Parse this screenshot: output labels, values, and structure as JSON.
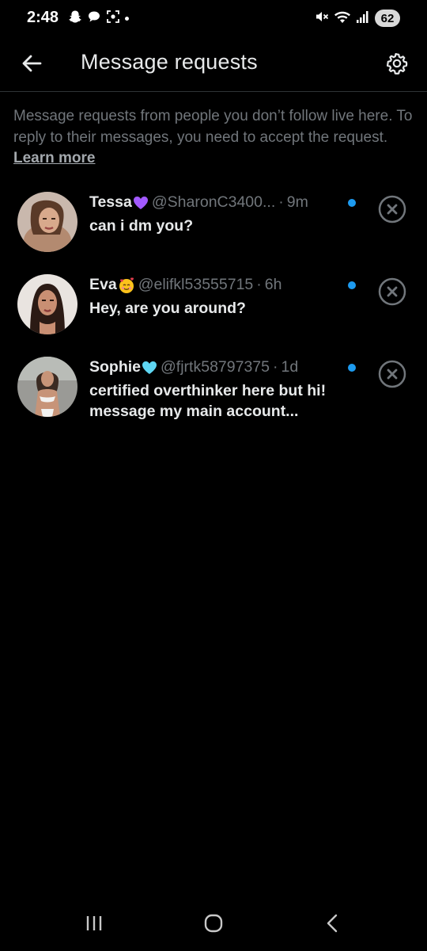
{
  "status_bar": {
    "time": "2:48",
    "battery": "62",
    "icons_left": [
      "snapchat-icon",
      "chat-bubble-icon",
      "screenshot-icon",
      "dot"
    ],
    "icons_right": [
      "mute-icon",
      "wifi-icon",
      "signal-icon",
      "battery-icon"
    ]
  },
  "header": {
    "title": "Message requests",
    "back_icon": "arrow-left-icon",
    "settings_icon": "gear-icon"
  },
  "description": {
    "text": "Message requests from people you don’t follow live here. To reply to their messages, you need to accept the request.",
    "link": "Learn more"
  },
  "requests": [
    {
      "name": "Tessa",
      "emoji": "purple-heart",
      "handle": "@SharonC3400...",
      "separator": "·",
      "time": "9m",
      "message": "can i dm you?",
      "unread": true
    },
    {
      "name": "Eva",
      "emoji": "smiling-face-with-hearts",
      "handle": "@elifkl53555715",
      "separator": "·",
      "time": "6h",
      "message": "Hey, are you around?",
      "unread": true
    },
    {
      "name": "Sophie",
      "emoji": "light-blue-heart",
      "handle": "@fjrtk58797375",
      "separator": "·",
      "time": "1d",
      "message": "certified overthinker here but hi! message my main account...",
      "unread": true
    }
  ],
  "colors": {
    "background": "#000000",
    "text_primary": "#e7e9ea",
    "text_secondary": "#71767b",
    "accent": "#1d9bf0",
    "divider": "#2f3336"
  },
  "nav_bar": {
    "icons": [
      "recent-apps-icon",
      "home-icon",
      "back-icon"
    ]
  }
}
